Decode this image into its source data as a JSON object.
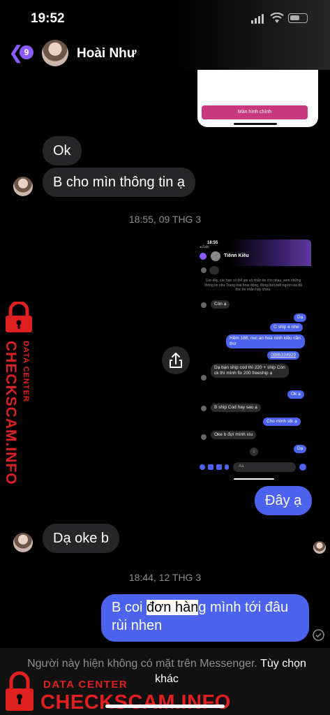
{
  "status": {
    "time": "19:52"
  },
  "header": {
    "unread_count": "9",
    "contact_name": "Hoài Như"
  },
  "top_image": {
    "button_label": "Màn hình chính"
  },
  "messages": {
    "ok": "Ok",
    "ask_info": "B cho mìn thông tin ạ",
    "ts1": "18:55, 09 THG 3",
    "here": "Đây ạ",
    "oke": "Dạ oke b",
    "ts2": "18:44, 12 THG 3",
    "order_part1": "B coi ",
    "order_highlight": "đơn hàn",
    "order_part2": "g mình tới đâu rùi nhen"
  },
  "screenshot": {
    "time": "18:55",
    "app_label": "◂ Zalo",
    "name": "Tiênn Kiều",
    "notice": "Giờ đây, các bạn có thể gọi và nhắn tin cho nhau, xem những thông tin như Trạng thái hoạt động, đồng thời biết người kia đã đọc tin nhắn hay chưa.",
    "m1": "Còn ạ",
    "m2": "Dạ",
    "m3": "C ship e nhé",
    "m4": "Hẻm 188, nvc an hoà ninh kiều cần thơ",
    "m5": "0886334929",
    "m6": "Dạ bạn ship cod thì 220 + ship Còn ck thì mình fix 200 freeship ạ",
    "m7": "Ok ạ",
    "m8": "B ship Cod hay sao ạ",
    "m9": "Cho mình stk ạ",
    "m10": "Oke b đợi mình xíu",
    "m11": "Dạ",
    "input_placeholder": "Aa"
  },
  "watermark": {
    "line1": "DATA CENTER",
    "line2": "CHECKSCAM.INFO"
  },
  "footer": {
    "notice": "Người này hiện không có mặt trên Messenger.",
    "options_link": "Tùy chọn khác"
  },
  "colors": {
    "accent": "#8a5cff",
    "outgoing": "#4b63ee",
    "incoming": "#262628",
    "watermark": "#e02020"
  }
}
